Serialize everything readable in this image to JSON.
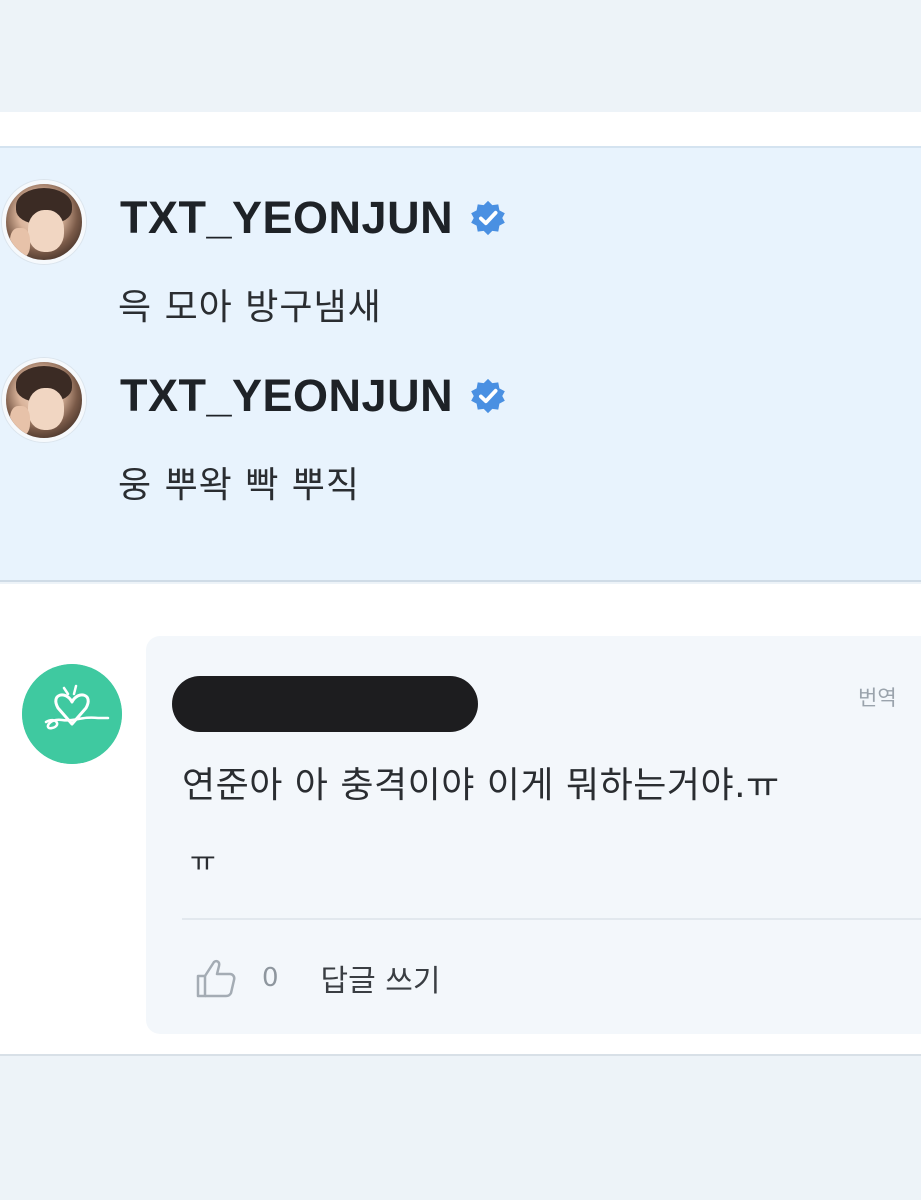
{
  "colors": {
    "verified_badge": "#4a90e2",
    "artist_panel_bg": "#e8f3fd",
    "comment_avatar_bg": "#3fc9a0",
    "redaction": "#1d1d1f"
  },
  "artist_posts": [
    {
      "username": "TXT_YEONJUN",
      "verified": true,
      "text": "윽 모아 방구냄새"
    },
    {
      "username": "TXT_YEONJUN",
      "verified": true,
      "text": "웅 뿌왁 빡 뿌직"
    }
  ],
  "comment": {
    "username_redacted": true,
    "translate_label": "번역",
    "text_line1": "연준아 아 충격이야 이게 뭐하는거야.ㅠ",
    "text_line2": "ㅠ",
    "like_count": "0",
    "reply_label": "답글 쓰기"
  }
}
